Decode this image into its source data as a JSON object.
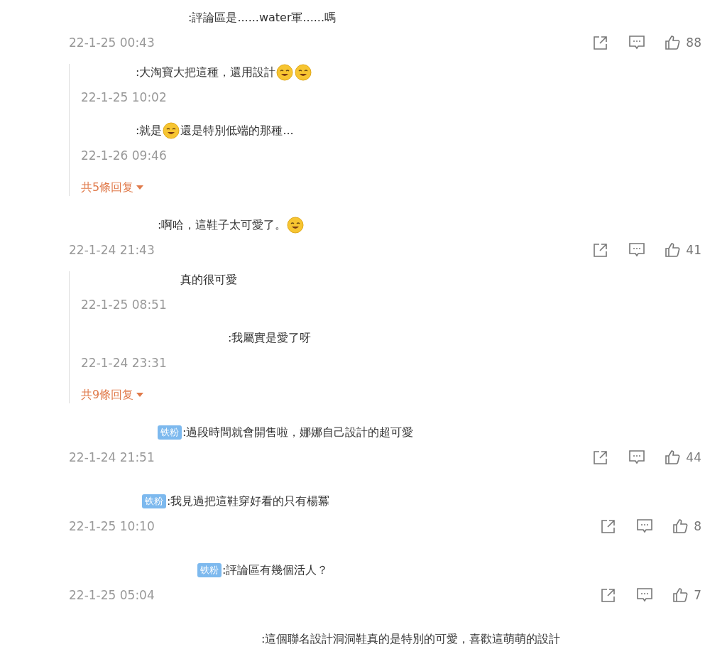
{
  "comments": [
    {
      "parts": [
        {
          "kind": "text",
          "text": ":評論區是......water軍......嗎"
        }
      ],
      "time": "22-1-25 00:43",
      "likes": "88",
      "replies": [
        {
          "parts": [
            {
              "kind": "text",
              "text": ":大淘寶大把這種，還用設計"
            },
            {
              "kind": "emoji"
            },
            {
              "kind": "emoji"
            }
          ],
          "time": "22-1-25 10:02"
        },
        {
          "parts": [
            {
              "kind": "text",
              "text": ":就是"
            },
            {
              "kind": "emoji"
            },
            {
              "kind": "text",
              "text": "還是特別低端的那種..."
            }
          ],
          "time": "22-1-26 09:46"
        }
      ],
      "more": "共5條回复"
    },
    {
      "parts": [
        {
          "kind": "text",
          "text": ":啊哈，這鞋子太可愛了。"
        },
        {
          "kind": "emoji"
        }
      ],
      "time": "22-1-24 21:43",
      "likes": "41",
      "replies": [
        {
          "parts": [
            {
              "kind": "text",
              "text": "真的很可愛"
            }
          ],
          "time": "22-1-25 08:51"
        },
        {
          "parts": [
            {
              "kind": "text",
              "text": ":我屬實是愛了呀"
            }
          ],
          "time": "22-1-24 23:31"
        }
      ],
      "more": "共9條回复"
    },
    {
      "badge": "铁粉",
      "parts": [
        {
          "kind": "text",
          "text": ":過段時間就會開售啦，娜娜自己設計的超可愛"
        }
      ],
      "time": "22-1-24 21:51",
      "likes": "44"
    },
    {
      "badge": "铁粉",
      "parts": [
        {
          "kind": "text",
          "text": ":我見過把這鞋穿好看的只有楊冪"
        }
      ],
      "time": "22-1-25 10:10",
      "likes": "8"
    },
    {
      "badge": "铁粉",
      "parts": [
        {
          "kind": "text",
          "text": ":評論區有幾個活人？"
        }
      ],
      "time": "22-1-25 05:04",
      "likes": "7"
    },
    {
      "parts": [
        {
          "kind": "text",
          "text": ":這個聯名設計洞洞鞋真的是特別的可愛，喜歡這萌萌的設計"
        }
      ]
    }
  ]
}
